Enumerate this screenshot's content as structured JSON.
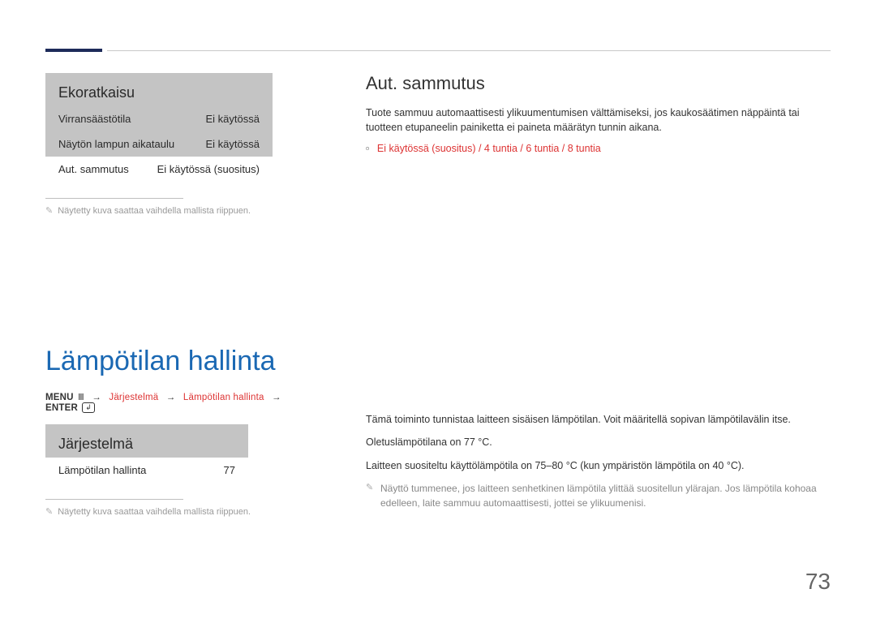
{
  "page_number": "73",
  "left": {
    "panel1": {
      "title": "Ekoratkaisu",
      "rows": [
        {
          "label": "Virransäästötila",
          "value": "Ei käytössä"
        },
        {
          "label": "Näytön lampun aikataulu",
          "value": "Ei käytössä"
        },
        {
          "label": "Aut. sammutus",
          "value": "Ei käytössä (suositus)"
        }
      ]
    },
    "footnote1": "Näytetty kuva saattaa vaihdella mallista riippuen.",
    "section_title": "Lämpötilan hallinta",
    "menu_line": {
      "menu": "MENU",
      "path1": "Järjestelmä",
      "path2": "Lämpötilan hallinta",
      "enter": "ENTER"
    },
    "panel2": {
      "title": "Järjestelmä",
      "row": {
        "label": "Lämpötilan hallinta",
        "value": "77"
      }
    },
    "footnote2": "Näytetty kuva saattaa vaihdella mallista riippuen."
  },
  "right": {
    "heading": "Aut. sammutus",
    "body": "Tuote sammuu automaattisesti ylikuumentumisen välttämiseksi, jos kaukosäätimen näppäintä tai tuotteen etupaneelin painiketta ei paineta määrätyn tunnin aikana.",
    "options": "Ei käytössä (suositus) / 4 tuntia / 6 tuntia / 8 tuntia",
    "lower": {
      "p1": "Tämä toiminto tunnistaa laitteen sisäisen lämpötilan. Voit määritellä sopivan lämpötilavälin itse.",
      "p2": "Oletuslämpötilana on 77 °C.",
      "p3": "Laitteen suositeltu käyttölämpötila on 75–80 °C (kun ympäristön lämpötila on 40 °C).",
      "note": "Näyttö tummenee, jos laitteen senhetkinen lämpötila ylittää suositellun ylärajan. Jos lämpötila kohoaa edelleen, laite sammuu automaattisesti, jottei se ylikuumenisi."
    }
  }
}
